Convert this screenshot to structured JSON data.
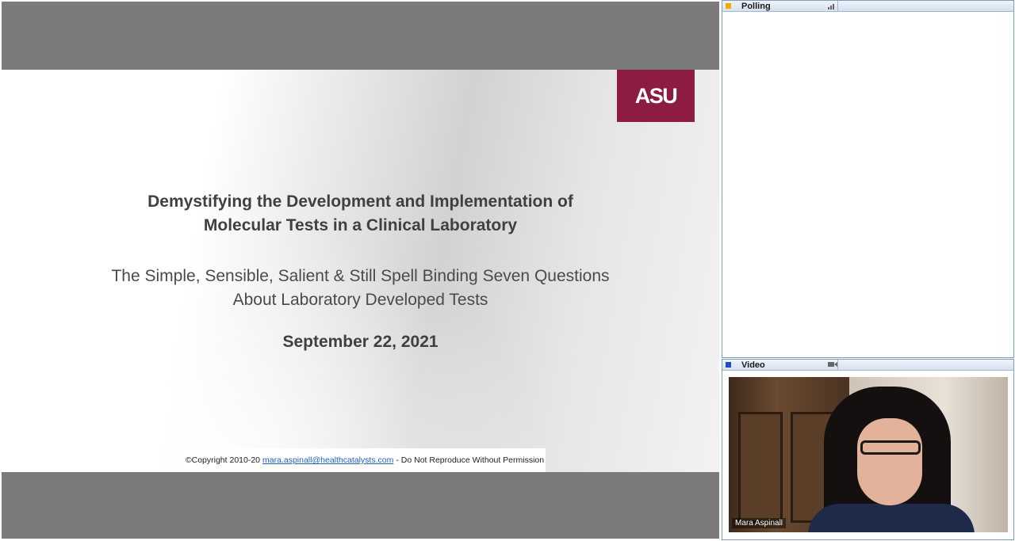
{
  "slide": {
    "logo_text": "ASU",
    "title_line1": "Demystifying the Development and Implementation of",
    "title_line2": "Molecular Tests in a Clinical Laboratory",
    "subtitle_line1": "The Simple, Sensible, Salient & Still Spell Binding Seven Questions",
    "subtitle_line2": "About Laboratory Developed Tests",
    "date": "September 22, 2021",
    "copyright_prefix": "©Copyright 2010-20",
    "copyright_email": "mara.aspinall@healthcatalysts.com",
    "copyright_suffix": "- Do Not Reproduce Without Permission"
  },
  "polling_panel": {
    "title": "Polling",
    "icon": "signal-bars-icon",
    "dot_color": "#f2a900"
  },
  "video_panel": {
    "title": "Video",
    "icon": "camera-icon",
    "dot_color": "#1f4fbf",
    "participant_name": "Mara Aspinall"
  },
  "colors": {
    "asu_maroon": "#8c1d40",
    "stage_gray": "#7a7a7a",
    "link_blue": "#1f5fbf"
  }
}
